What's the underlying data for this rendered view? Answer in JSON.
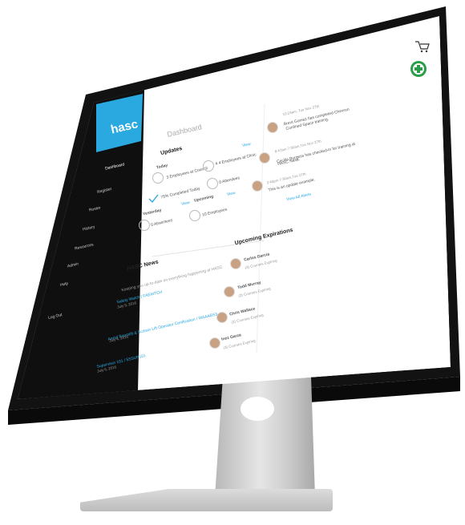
{
  "sidebar": {
    "logo": "hasc",
    "items": [
      {
        "label": "Dashboard"
      },
      {
        "label": "Register"
      },
      {
        "label": "Roster"
      },
      {
        "label": "History"
      },
      {
        "label": "Resources"
      },
      {
        "label": "Admin"
      },
      {
        "label": "Help"
      },
      {
        "label": "Log Out"
      }
    ]
  },
  "header": {
    "title": "Dashboard"
  },
  "updates": {
    "title": "Updates",
    "today": "Today",
    "yesterday": "Yesterday",
    "upcoming": "Upcoming",
    "view1": "View",
    "view2": "View",
    "view3": "View",
    "today_items": [
      "3 Employees at Council",
      "4 4 Employees at Clinic",
      "75% Completed Today",
      "0 Attendees"
    ],
    "yesterday_items": [
      "0 Absentees",
      "10 Employees"
    ]
  },
  "activity": [
    {
      "time": "10:23am, Tue Nov 27th",
      "text1": "Brent Gomez has completed Chevron",
      "text2": "Confined Space training."
    },
    {
      "time": "8:47am  7:30am,Tue Nov 27th",
      "text1": "Cecilia Burgess has checked-in for training at",
      "text2": "HASC Nasa."
    },
    {
      "time": "3:45pm 7:30am,Tue 27th",
      "text1": "This is an update example.",
      "text2": ""
    }
  ],
  "view_all": "View All Alerts",
  "expirations": {
    "title": "Upcoming Expirations",
    "people": [
      {
        "name": "Carlos Garcia",
        "detail": "(3) Courses Expiring"
      },
      {
        "name": "Todd Murray",
        "detail": "(2) Courses Expiring"
      },
      {
        "name": "Chris Wallace",
        "detail": "(2) Courses Expiring"
      },
      {
        "name": "Inez Garza",
        "detail": "(3) Courses Expiring"
      }
    ]
  },
  "news": {
    "title": "HASC News",
    "subtitle": "Keeping you up-to-date on everything happening at HASC",
    "items": [
      {
        "title": "Safety Watch | FAEWTCH",
        "date": "July 9, 2016"
      },
      {
        "title": "Aerial Boomlift & Scissor Lift Operator Certification / WAAABS3",
        "date": "July 4, 2016"
      },
      {
        "title": "Supervisor 101 / 5SSUP101",
        "date": "July 6, 2016"
      }
    ]
  },
  "icons": {
    "cart": "cart-icon",
    "badge": "safety-cross-icon",
    "apple": "apple-logo-icon"
  }
}
